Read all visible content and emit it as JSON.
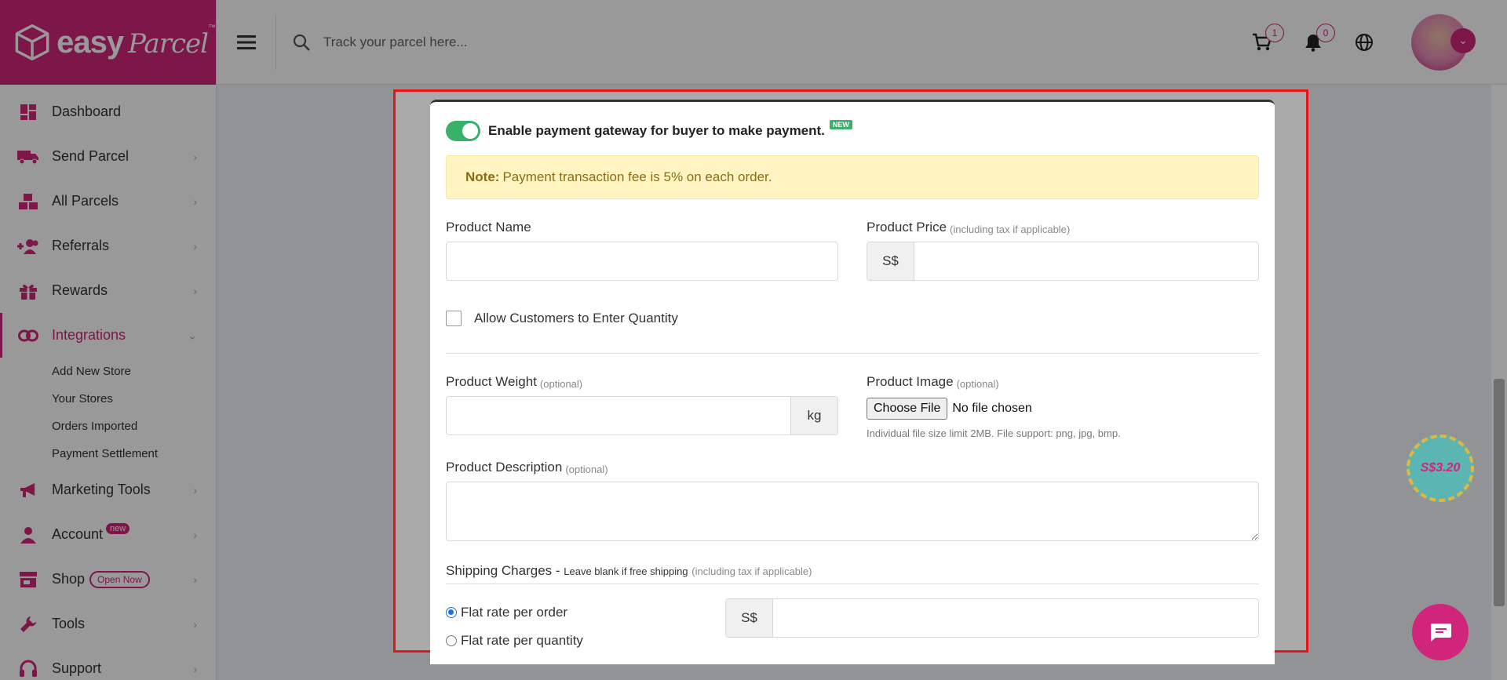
{
  "brand": {
    "name": "easy",
    "script": "Parcel",
    "tm": "™"
  },
  "search": {
    "placeholder": "Track your parcel here..."
  },
  "top": {
    "cart_count": "1",
    "notif_count": "0"
  },
  "sidebar": {
    "items": [
      {
        "label": "Dashboard",
        "icon": "dashboard-icon"
      },
      {
        "label": "Send Parcel",
        "icon": "truck-icon"
      },
      {
        "label": "All Parcels",
        "icon": "boxes-icon"
      },
      {
        "label": "Referrals",
        "icon": "user-plus-icon"
      },
      {
        "label": "Rewards",
        "icon": "gift-icon"
      },
      {
        "label": "Integrations",
        "icon": "link-icon"
      },
      {
        "label": "Marketing Tools",
        "icon": "megaphone-icon"
      },
      {
        "label": "Account",
        "icon": "user-icon",
        "badge": "new"
      },
      {
        "label": "Shop",
        "icon": "store-icon",
        "badge": "Open Now"
      },
      {
        "label": "Tools",
        "icon": "wrench-icon"
      },
      {
        "label": "Support",
        "icon": "headset-icon"
      }
    ],
    "integrations_sub": [
      "Add New Store",
      "Your Stores",
      "Orders Imported",
      "Payment Settlement"
    ]
  },
  "promo": {
    "text": "S$3.20"
  },
  "form": {
    "toggle_label": "Enable payment gateway for buyer to make payment.",
    "toggle_badge": "NEW",
    "note_bold": "Note:",
    "note_text": "Payment transaction fee is 5% on each order.",
    "product_name_label": "Product Name",
    "product_price_label": "Product Price",
    "product_price_hint": "(including tax if applicable)",
    "currency": "S$",
    "allow_qty_label": "Allow Customers to Enter Quantity",
    "weight_label": "Product Weight",
    "optional": "(optional)",
    "weight_unit": "kg",
    "image_label": "Product Image",
    "choose_file": "Choose File",
    "no_file": "No file chosen",
    "file_hint": "Individual file size limit 2MB. File support: png, jpg, bmp.",
    "description_label": "Product Description",
    "shipping_label": "Shipping Charges",
    "shipping_dash": " - ",
    "shipping_small": "Leave blank if free shipping",
    "shipping_hint": "(including tax if applicable)",
    "radio_per_order": "Flat rate per order",
    "radio_per_qty": "Flat rate per quantity"
  },
  "colors": {
    "brand": "#d0257a",
    "toggle_on": "#38b26b",
    "note_bg": "#fff4c2",
    "frame": "#e8141b"
  }
}
